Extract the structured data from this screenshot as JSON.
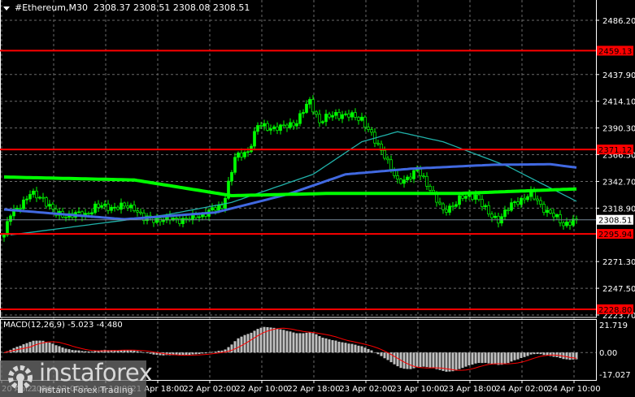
{
  "header": {
    "symbol": "#Ethereum,M30",
    "ohlc": "2308.37 2308.51 2308.08 2308.51"
  },
  "macd_label": "MACD(12,26,9) -5.023 -4.480",
  "watermark": {
    "brand": "instaforex",
    "tagline": "Instant Forex Trading"
  },
  "colors": {
    "bg": "#000000",
    "candle": "#00ff00",
    "ma_slow": "#00ff00",
    "ma_mid": "#4169e1",
    "ma_fast": "#20b2aa",
    "level": "#ff0000",
    "signal": "#ff0000",
    "hist": "#c0c0c0"
  },
  "chart_data": {
    "type": "candlestick",
    "price_axis": {
      "ticks": [
        "2486.20",
        "2437.90",
        "2414.10",
        "2390.30",
        "2366.50",
        "2342.70",
        "2318.90",
        "2271.30",
        "2247.50",
        "2223.70"
      ],
      "range": [
        2223.7,
        2486.2
      ]
    },
    "levels": [
      {
        "label": "2459.13",
        "value": 2459.13
      },
      {
        "label": "2371.12",
        "value": 2371.12
      },
      {
        "label": "2295.94",
        "value": 2295.94
      },
      {
        "label": "2228.80",
        "value": 2228.8
      }
    ],
    "current_price": {
      "label": "2308.51",
      "value": 2308.51
    },
    "time_labels": [
      "20 Apr 2024",
      "21 Apr 02:00",
      "21 Apr 10:00",
      "21 Apr 18:00",
      "22 Apr 02:00",
      "22 Apr 10:00",
      "22 Apr 18:00",
      "23 Apr 02:00",
      "23 Apr 10:00",
      "23 Apr 18:00",
      "24 Apr 02:00",
      "24 Apr 10:00"
    ],
    "bars_per_label": 16,
    "close_keypoints": [
      [
        0,
        2295
      ],
      [
        2,
        2313
      ],
      [
        8,
        2331
      ],
      [
        12,
        2328
      ],
      [
        16,
        2313
      ],
      [
        25,
        2313
      ],
      [
        28,
        2320
      ],
      [
        40,
        2320
      ],
      [
        43,
        2309
      ],
      [
        57,
        2309
      ],
      [
        62,
        2315
      ],
      [
        67,
        2320
      ],
      [
        71,
        2363
      ],
      [
        75,
        2370
      ],
      [
        78,
        2392
      ],
      [
        85,
        2390
      ],
      [
        90,
        2396
      ],
      [
        94,
        2414
      ],
      [
        97,
        2396
      ],
      [
        102,
        2403
      ],
      [
        110,
        2399
      ],
      [
        114,
        2378
      ],
      [
        117,
        2367
      ],
      [
        121,
        2341
      ],
      [
        127,
        2352
      ],
      [
        131,
        2337
      ],
      [
        135,
        2315
      ],
      [
        140,
        2327
      ],
      [
        145,
        2331
      ],
      [
        149,
        2313
      ],
      [
        152,
        2309
      ],
      [
        157,
        2324
      ],
      [
        162,
        2331
      ],
      [
        167,
        2316
      ],
      [
        172,
        2305
      ],
      [
        176,
        2308.5
      ]
    ],
    "ma_slow": [
      [
        0,
        2346.6
      ],
      [
        40,
        2344
      ],
      [
        70,
        2330
      ],
      [
        100,
        2332
      ],
      [
        140,
        2332
      ],
      [
        176,
        2336
      ]
    ],
    "ma_mid": [
      [
        0,
        2317.7
      ],
      [
        37,
        2309
      ],
      [
        65,
        2315
      ],
      [
        87,
        2331
      ],
      [
        105,
        2349
      ],
      [
        125,
        2354
      ],
      [
        150,
        2357.5
      ],
      [
        168,
        2358
      ],
      [
        176,
        2355
      ]
    ],
    "ma_fast": [
      [
        2,
        2295
      ],
      [
        50,
        2313
      ],
      [
        70,
        2324
      ],
      [
        95,
        2349
      ],
      [
        110,
        2378
      ],
      [
        121,
        2387
      ],
      [
        135,
        2378
      ],
      [
        155,
        2356
      ],
      [
        176,
        2325
      ]
    ],
    "macd_axis": {
      "ticks": [
        "21.719",
        "0.00",
        "-17.027"
      ],
      "range": [
        -17.027,
        21.719
      ]
    }
  }
}
